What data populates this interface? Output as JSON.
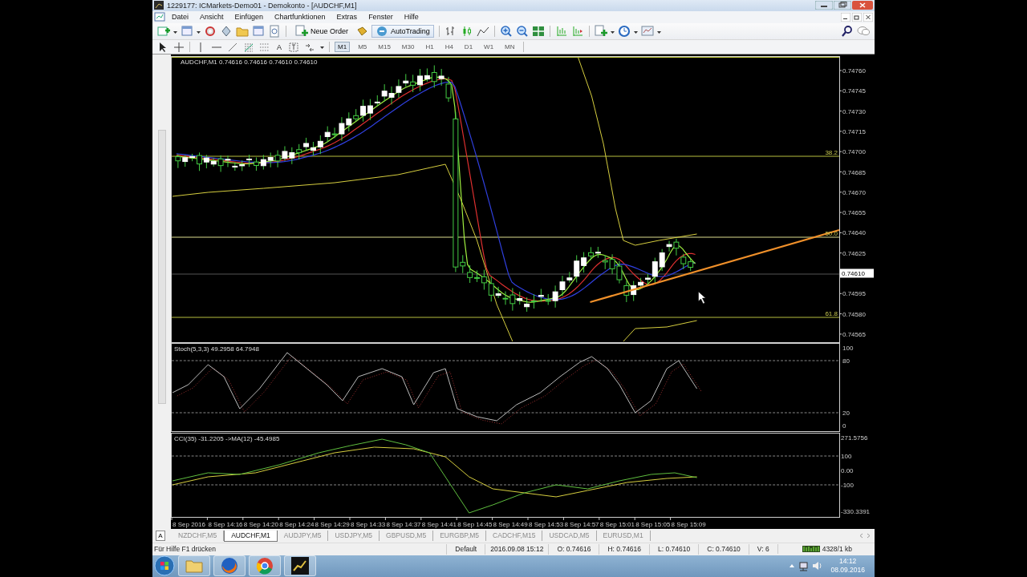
{
  "window": {
    "title": "1229177: ICMarkets-Demo01 - Demokonto - [AUDCHF,M1]"
  },
  "menu": [
    "Datei",
    "Ansicht",
    "Einfügen",
    "Chartfunktionen",
    "Extras",
    "Fenster",
    "Hilfe"
  ],
  "toolbar": {
    "new_order": "Neue Order",
    "auto_trading": "AutoTrading"
  },
  "drawing_toolbar": {
    "text_tool": "A",
    "timeframes": [
      {
        "label": "M1",
        "selected": true
      },
      {
        "label": "M5",
        "selected": false
      },
      {
        "label": "M15",
        "selected": false
      },
      {
        "label": "M30",
        "selected": false
      },
      {
        "label": "H1",
        "selected": false
      },
      {
        "label": "H4",
        "selected": false
      },
      {
        "label": "D1",
        "selected": false
      },
      {
        "label": "W1",
        "selected": false
      },
      {
        "label": "MN",
        "selected": false
      }
    ]
  },
  "chart": {
    "legend": "AUDCHF,M1  0.74616 0.74616 0.74610 0.74610",
    "price_axis": [
      {
        "label": "0.74760",
        "kind": "tick"
      },
      {
        "label": "0.74745",
        "kind": "tick"
      },
      {
        "label": "0.74730",
        "kind": "tick"
      },
      {
        "label": "0.74715",
        "kind": "tick"
      },
      {
        "label": "0.74700",
        "kind": "tick"
      },
      {
        "label": "0.74685",
        "kind": "tick"
      },
      {
        "label": "0.74670",
        "kind": "tick"
      },
      {
        "label": "0.74655",
        "kind": "tick"
      },
      {
        "label": "0.74640",
        "kind": "tick"
      },
      {
        "label": "0.74625",
        "kind": "tick"
      },
      {
        "label": "0.74610",
        "kind": "current"
      },
      {
        "label": "0.74595",
        "kind": "tick"
      },
      {
        "label": "0.74580",
        "kind": "tick"
      },
      {
        "label": "0.74565",
        "kind": "tick"
      }
    ],
    "fib_levels": [
      "38.2",
      "50.0",
      "61.8"
    ],
    "stochastic": {
      "legend": "Stoch(5,3,3) 49.2958 64.7948",
      "axis": [
        "100",
        "80",
        "20",
        "0"
      ]
    },
    "cci": {
      "legend": "CCI(35) -31.2205  ->MA(12) -45.4985",
      "axis": [
        "271.5756",
        "100",
        "0.00",
        "-100",
        "-330.3391"
      ]
    },
    "time_axis": [
      "8 Sep 2016",
      "8 Sep 14:16",
      "8 Sep 14:20",
      "8 Sep 14:24",
      "8 Sep 14:29",
      "8 Sep 14:33",
      "8 Sep 14:37",
      "8 Sep 14:41",
      "8 Sep 14:45",
      "8 Sep 14:49",
      "8 Sep 14:53",
      "8 Sep 14:57",
      "8 Sep 15:01",
      "8 Sep 15:05",
      "8 Sep 15:09"
    ]
  },
  "tabs_button": "A",
  "chart_tabs": [
    {
      "label": "NZDCHF,M5",
      "selected": false
    },
    {
      "label": "AUDCHF,M1",
      "selected": true
    },
    {
      "label": "AUDJPY,M5",
      "selected": false
    },
    {
      "label": "USDJPY,M5",
      "selected": false
    },
    {
      "label": "GBPUSD,M5",
      "selected": false
    },
    {
      "label": "EURGBP,M5",
      "selected": false
    },
    {
      "label": "CADCHF,M15",
      "selected": false
    },
    {
      "label": "USDCAD,M5",
      "selected": false
    },
    {
      "label": "EURUSD,M1",
      "selected": false
    }
  ],
  "status_bar": {
    "help": "Für Hilfe F1 drücken",
    "profile": "Default",
    "datetime": "2016.09.08 15:12",
    "open": "O: 0.74616",
    "high": "H: 0.74616",
    "low": "L: 0.74610",
    "close": "C: 0.74610",
    "volume": "V: 6",
    "traffic": "4328/1 kb"
  },
  "taskbar": {
    "time": "14:12",
    "date": "08.09.2016"
  }
}
